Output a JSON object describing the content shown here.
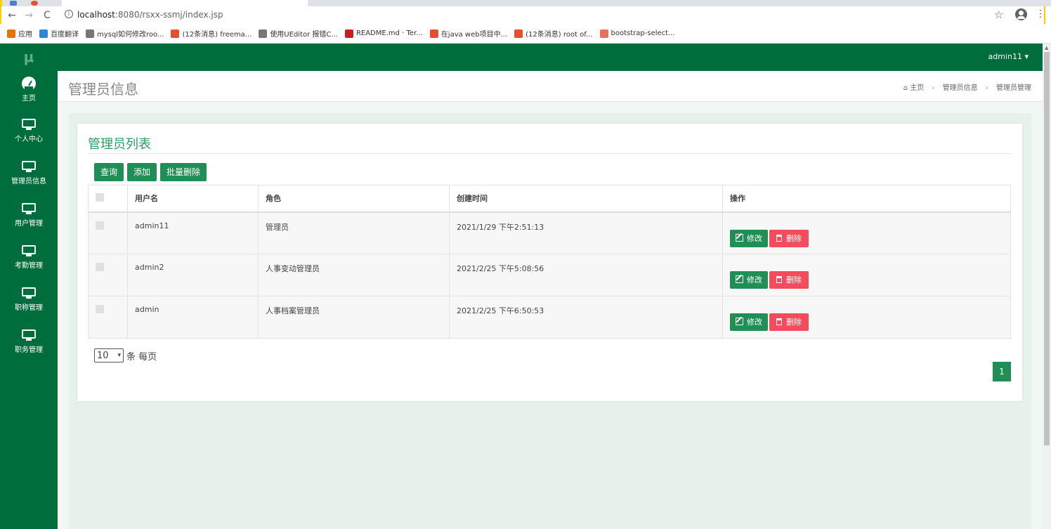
{
  "browser": {
    "url": "localhost:8080/rsxx-ssmj/index.jsp",
    "url_host": "localhost",
    "url_rest": ":8080/rsxx-ssmj/index.jsp",
    "bookmarks": [
      {
        "label": "应用",
        "icon": "apps-grid-icon",
        "color": "#e37400"
      },
      {
        "label": "百度翻译",
        "icon": "translate-icon",
        "color": "#2b88d8"
      },
      {
        "label": "mysql如何修改roo...",
        "icon": "csdn-icon",
        "color": "#777777"
      },
      {
        "label": "(12条消息) freema...",
        "icon": "c-icon",
        "color": "#e4502e"
      },
      {
        "label": "使用UEditor 报错C...",
        "icon": "csdn-icon",
        "color": "#777777"
      },
      {
        "label": "README.md · Ter...",
        "icon": "gitee-icon",
        "color": "#c71d23"
      },
      {
        "label": "在java web项目中...",
        "icon": "c-icon",
        "color": "#e4502e"
      },
      {
        "label": "(12条消息) root of...",
        "icon": "c-icon",
        "color": "#e4502e"
      },
      {
        "label": "bootstrap-select...",
        "icon": "jianshu-icon",
        "color": "#ea6f5a"
      }
    ]
  },
  "sidebar": {
    "logo": "μ",
    "items": [
      {
        "label": "主页",
        "icon": "dashboard-icon"
      },
      {
        "label": "个人中心",
        "icon": "monitor-icon"
      },
      {
        "label": "管理员信息",
        "icon": "monitor-icon"
      },
      {
        "label": "用户管理",
        "icon": "monitor-icon"
      },
      {
        "label": "考勤管理",
        "icon": "monitor-icon"
      },
      {
        "label": "职称管理",
        "icon": "monitor-icon"
      },
      {
        "label": "职务管理",
        "icon": "monitor-icon"
      }
    ]
  },
  "topbar": {
    "user": "admin11 ▾"
  },
  "header": {
    "title": "管理员信息",
    "breadcrumb": [
      "主页",
      "管理员信息",
      "管理员管理"
    ]
  },
  "panel": {
    "title": "管理员列表",
    "buttons": {
      "query": "查询",
      "add": "添加",
      "batch_delete": "批量删除"
    },
    "columns": [
      "用户名",
      "角色",
      "创建时间",
      "操作"
    ],
    "rows": [
      {
        "username": "admin11",
        "role": "管理员",
        "created": "2021/1/29 下午2:51:13"
      },
      {
        "username": "admin2",
        "role": "人事变动管理员",
        "created": "2021/2/25 下午5:08:56"
      },
      {
        "username": "admin",
        "role": "人事档案管理员",
        "created": "2021/2/25 下午6:50:53"
      }
    ],
    "edit_label": "修改",
    "delete_label": "删除",
    "page_size": "10",
    "page_size_suffix": "条 每页",
    "current_page": "1"
  },
  "colors": {
    "primary": "#006d3c",
    "button": "#1f8f55",
    "danger": "#f44b5d",
    "title": "#2e9c63"
  }
}
